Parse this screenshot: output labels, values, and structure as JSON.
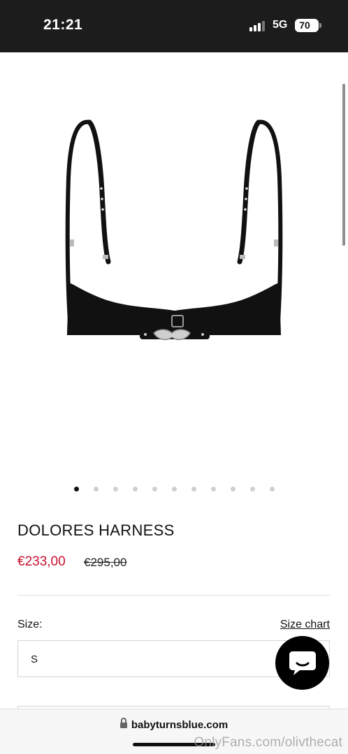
{
  "status_bar": {
    "time": "21:21",
    "network": "5G",
    "battery": "70",
    "icons": [
      "signal-icon",
      "battery-icon"
    ]
  },
  "product": {
    "title": "DOLORES HARNESS",
    "price_sale": "€233,00",
    "price_original": "€295,00",
    "gallery": {
      "total_images": 11,
      "active_index": 0
    }
  },
  "size": {
    "label": "Size:",
    "chart_link": "Size chart",
    "selected": "S"
  },
  "chat": {
    "icon": "chat-bubble-icon"
  },
  "browser": {
    "url": "babyturnsblue.com",
    "icon": "lock-icon"
  },
  "watermark": "OnlyFans.com/olivthecat",
  "colors": {
    "status_bar_bg": "#1c1c1c",
    "sale_price": "#c8102e",
    "chat_button_bg": "#000000"
  }
}
